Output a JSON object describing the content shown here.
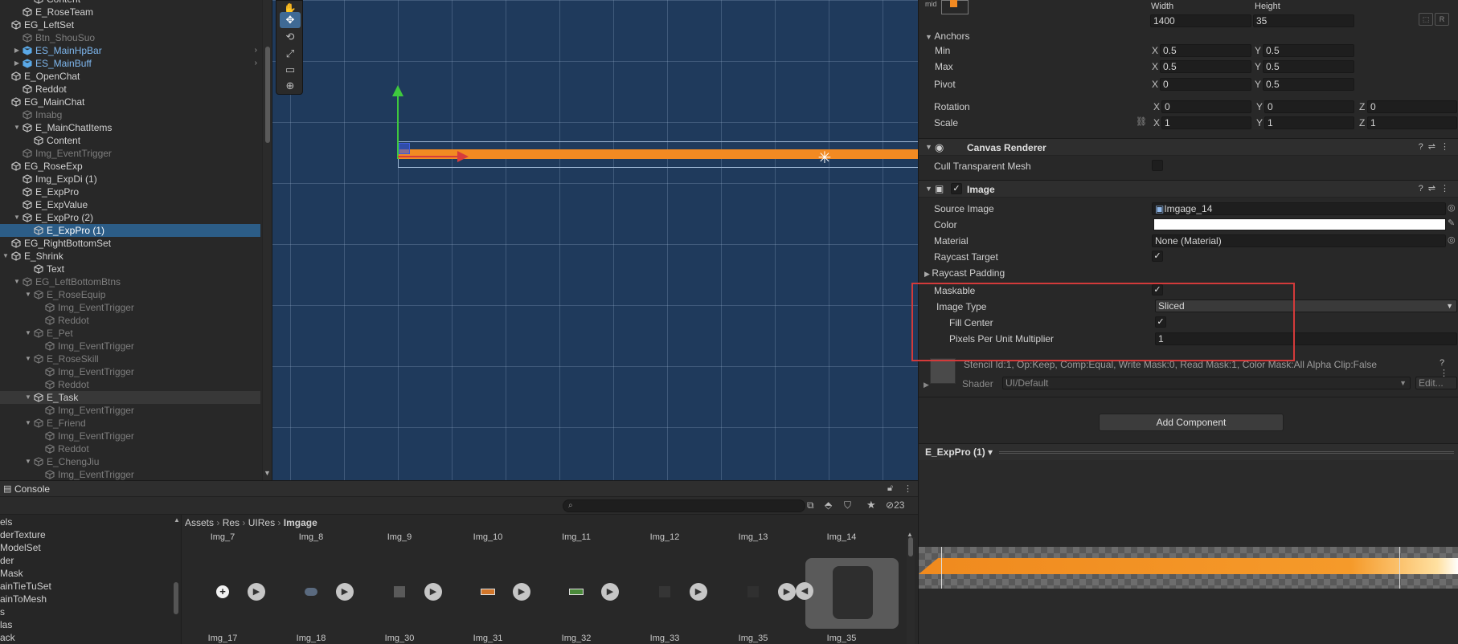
{
  "hierarchy": {
    "rows": [
      {
        "label": "Content",
        "depth": 2,
        "fold": "",
        "style": "normal"
      },
      {
        "label": "E_RoseTeam",
        "depth": 1,
        "fold": "",
        "style": "normal"
      },
      {
        "label": "EG_LeftSet",
        "depth": 0,
        "fold": "",
        "style": "normal"
      },
      {
        "label": "Btn_ShouSuo",
        "depth": 1,
        "fold": "",
        "style": "dim"
      },
      {
        "label": "ES_MainHpBar",
        "depth": 1,
        "fold": "▶",
        "style": "prefab",
        "arrow": true
      },
      {
        "label": "ES_MainBuff",
        "depth": 1,
        "fold": "▶",
        "style": "prefab",
        "arrow": true
      },
      {
        "label": "E_OpenChat",
        "depth": 0,
        "fold": "",
        "style": "normal"
      },
      {
        "label": "Reddot",
        "depth": 1,
        "fold": "",
        "style": "normal"
      },
      {
        "label": "EG_MainChat",
        "depth": 0,
        "fold": "",
        "style": "normal"
      },
      {
        "label": "Imabg",
        "depth": 1,
        "fold": "",
        "style": "dim"
      },
      {
        "label": "E_MainChatItems",
        "depth": 1,
        "fold": "▼",
        "style": "normal"
      },
      {
        "label": "Content",
        "depth": 2,
        "fold": "",
        "style": "normal"
      },
      {
        "label": "Img_EventTrigger",
        "depth": 1,
        "fold": "",
        "style": "dim"
      },
      {
        "label": "EG_RoseExp",
        "depth": 0,
        "fold": "",
        "style": "normal"
      },
      {
        "label": "Img_ExpDi (1)",
        "depth": 1,
        "fold": "",
        "style": "normal"
      },
      {
        "label": "E_ExpPro",
        "depth": 1,
        "fold": "",
        "style": "normal"
      },
      {
        "label": "E_ExpValue",
        "depth": 1,
        "fold": "",
        "style": "normal"
      },
      {
        "label": "E_ExpPro (2)",
        "depth": 1,
        "fold": "▼",
        "style": "normal"
      },
      {
        "label": "E_ExpPro (1)",
        "depth": 2,
        "fold": "",
        "style": "selected"
      },
      {
        "label": "EG_RightBottomSet",
        "depth": 0,
        "fold": "",
        "style": "normal"
      },
      {
        "label": "E_Shrink",
        "depth": 0,
        "fold": "▼",
        "style": "normal"
      },
      {
        "label": "Text",
        "depth": 2,
        "fold": "",
        "style": "normal"
      },
      {
        "label": "EG_LeftBottomBtns",
        "depth": 1,
        "fold": "▼",
        "style": "dim"
      },
      {
        "label": "E_RoseEquip",
        "depth": 2,
        "fold": "▼",
        "style": "dim"
      },
      {
        "label": "Img_EventTrigger",
        "depth": 3,
        "fold": "",
        "style": "dim"
      },
      {
        "label": "Reddot",
        "depth": 3,
        "fold": "",
        "style": "dim"
      },
      {
        "label": "E_Pet",
        "depth": 2,
        "fold": "▼",
        "style": "dim"
      },
      {
        "label": "Img_EventTrigger",
        "depth": 3,
        "fold": "",
        "style": "dim"
      },
      {
        "label": "E_RoseSkill",
        "depth": 2,
        "fold": "▼",
        "style": "dim"
      },
      {
        "label": "Img_EventTrigger",
        "depth": 3,
        "fold": "",
        "style": "dim"
      },
      {
        "label": "Reddot",
        "depth": 3,
        "fold": "",
        "style": "dim"
      },
      {
        "label": "E_Task",
        "depth": 2,
        "fold": "▼",
        "style": "hover"
      },
      {
        "label": "Img_EventTrigger",
        "depth": 3,
        "fold": "",
        "style": "dim"
      },
      {
        "label": "E_Friend",
        "depth": 2,
        "fold": "▼",
        "style": "dim"
      },
      {
        "label": "Img_EventTrigger",
        "depth": 3,
        "fold": "",
        "style": "dim"
      },
      {
        "label": "Reddot",
        "depth": 3,
        "fold": "",
        "style": "dim"
      },
      {
        "label": "E_ChengJiu",
        "depth": 2,
        "fold": "▼",
        "style": "dim"
      },
      {
        "label": "Img_EventTrigger",
        "depth": 3,
        "fold": "",
        "style": "dim"
      }
    ]
  },
  "scene": {
    "tools": [
      "✋",
      "✥",
      "⟲",
      "⤢",
      "▭",
      "⊕"
    ],
    "bar_color": "#f28a22"
  },
  "inspector": {
    "rect": {
      "anchor_preset": "mid",
      "width_label": "Width",
      "height_label": "Height",
      "width": "1400",
      "height": "35",
      "anchors_label": "Anchors",
      "min_label": "Min",
      "max_label": "Max",
      "pivot_label": "Pivot",
      "min_x": "0.5",
      "min_y": "0.5",
      "max_x": "0.5",
      "max_y": "0.5",
      "pivot_x": "0",
      "pivot_y": "0.5",
      "rotation_label": "Rotation",
      "scale_label": "Scale",
      "rot_x": "0",
      "rot_y": "0",
      "rot_z": "0",
      "scale_x": "1",
      "scale_y": "1",
      "scale_z": "1",
      "axis_x": "X",
      "axis_y": "Y",
      "axis_z": "Z"
    },
    "canvas_renderer": {
      "title": "Canvas Renderer",
      "cull_label": "Cull Transparent Mesh"
    },
    "image": {
      "title": "Image",
      "source_label": "Source Image",
      "source_value": "Imgage_14",
      "color_label": "Color",
      "color_value": "#ffffff",
      "material_label": "Material",
      "material_value": "None (Material)",
      "raycast_label": "Raycast Target",
      "raycast_padding_label": "Raycast Padding",
      "maskable_label": "Maskable",
      "image_type_label": "Image Type",
      "image_type_value": "Sliced",
      "fill_center_label": "Fill Center",
      "ppu_label": "Pixels Per Unit Multiplier",
      "ppu_value": "1"
    },
    "material_info": "Stencil Id:1, Op:Keep, Comp:Equal, Write Mask:0, Read Mask:1, Color Mask:All Alpha Clip:False",
    "shader_label": "Shader",
    "shader_value": "UI/Default",
    "edit_label": "Edit...",
    "add_component": "Add Component"
  },
  "preview": {
    "title": "E_ExpPro (1) ▾"
  },
  "console": {
    "tab": "Console",
    "hidden_count": "23",
    "left_items": [
      "els",
      "derTexture",
      "ModelSet",
      "der",
      "Mask",
      "ainTieTuSet",
      "ainToMesh",
      "s",
      "las",
      "ack"
    ],
    "breadcrumb": [
      "Assets",
      "Res",
      "UIRes",
      "Imgage"
    ],
    "row1_names": [
      "Img_7",
      "Img_8",
      "Img_9",
      "Img_10",
      "Img_11",
      "Img_12",
      "Img_13",
      "Img_14"
    ],
    "row2_names": [
      "Img_17",
      "Img_18",
      "Img_30",
      "Img_31",
      "Img_32",
      "Img_33",
      "Img_35",
      "Img_35"
    ]
  }
}
